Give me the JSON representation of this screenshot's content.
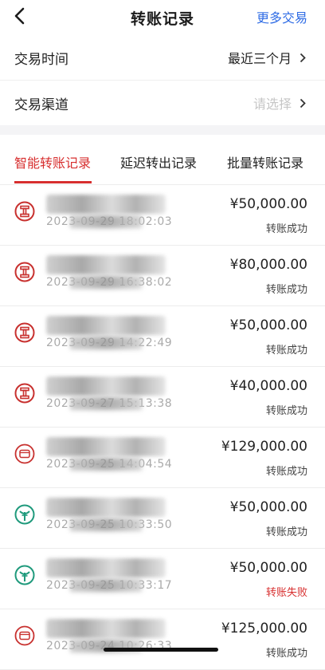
{
  "header": {
    "title": "转账记录",
    "more_label": "更多交易",
    "back_icon": "chevron-left-icon"
  },
  "filters": [
    {
      "label": "交易时间",
      "value": "最近三个月",
      "placeholder": false
    },
    {
      "label": "交易渠道",
      "value": "请选择",
      "placeholder": true
    }
  ],
  "tabs": [
    {
      "label": "智能转账记录",
      "active": true
    },
    {
      "label": "延迟转出记录",
      "active": false
    },
    {
      "label": "批量转账记录",
      "active": false
    }
  ],
  "records": [
    {
      "name_suffix": ")",
      "time": "2023-09-29 18:02:03",
      "amount": "¥50,000.00",
      "status": "转账成功",
      "failed": false,
      "icon": "icbc-bank-icon"
    },
    {
      "name_suffix": "030)",
      "time": "2023-09-29 16:38:02",
      "amount": "¥80,000.00",
      "status": "转账成功",
      "failed": false,
      "icon": "icbc-bank-icon"
    },
    {
      "name_suffix": "",
      "time": "2023-09-29 14:22:49",
      "amount": "¥50,000.00",
      "status": "转账成功",
      "failed": false,
      "icon": "icbc-bank-icon"
    },
    {
      "name_suffix": "0)",
      "time": "2023-09-27 15:13:38",
      "amount": "¥40,000.00",
      "status": "转账成功",
      "failed": false,
      "icon": "icbc-bank-icon"
    },
    {
      "name_suffix": "",
      "time": "2023-09-25 14:04:54",
      "amount": "¥129,000.00",
      "status": "转账成功",
      "failed": false,
      "icon": "card-icon"
    },
    {
      "name_suffix": "",
      "time": "2023-09-25 10:33:50",
      "amount": "¥50,000.00",
      "status": "转账成功",
      "failed": false,
      "icon": "abc-bank-icon"
    },
    {
      "name_suffix": "77)",
      "time": "2023-09-25 10:33:17",
      "amount": "¥50,000.00",
      "status": "转账失败",
      "failed": true,
      "icon": "abc-bank-icon"
    },
    {
      "name_suffix": "8)",
      "time": "2023-09-24 10:26:33",
      "amount": "¥125,000.00",
      "status": "转账成功",
      "failed": false,
      "icon": "card-icon"
    }
  ],
  "colors": {
    "accent": "#d72f2f",
    "link": "#2f6ce5",
    "abc_green": "#1f9a7c"
  }
}
